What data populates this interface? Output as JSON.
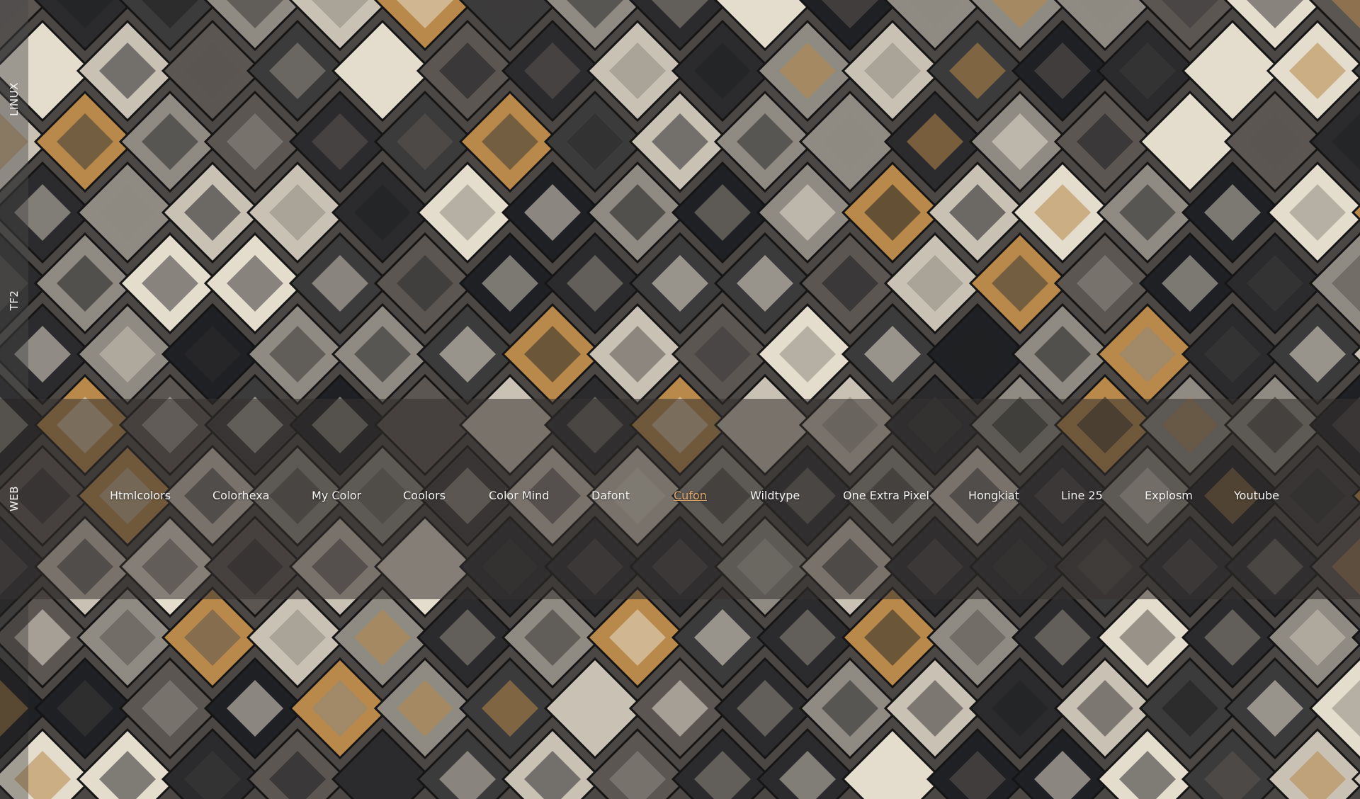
{
  "sidebar": {
    "sections": [
      {
        "label": "LINUX"
      },
      {
        "label": "TF2"
      },
      {
        "label": "WEB"
      }
    ]
  },
  "web": {
    "links": [
      {
        "label": "Htmlcolors"
      },
      {
        "label": "Colorhexa"
      },
      {
        "label": "My Color"
      },
      {
        "label": "Coolors"
      },
      {
        "label": "Color Mind"
      },
      {
        "label": "Dafont"
      },
      {
        "label": "Cufon",
        "active": true
      },
      {
        "label": "Wildtype"
      },
      {
        "label": "One Extra Pixel"
      },
      {
        "label": "Hongkiat"
      },
      {
        "label": "Line 25"
      },
      {
        "label": "Explosm"
      },
      {
        "label": "Youtube"
      }
    ],
    "active_color": "#e0a86e"
  },
  "wallpaper": {
    "colors": [
      "#2b2b2d",
      "#3c3b3b",
      "#5b5652",
      "#8f8a82",
      "#c9c1b4",
      "#e4dccd",
      "#b8894a",
      "#1f2023"
    ]
  }
}
